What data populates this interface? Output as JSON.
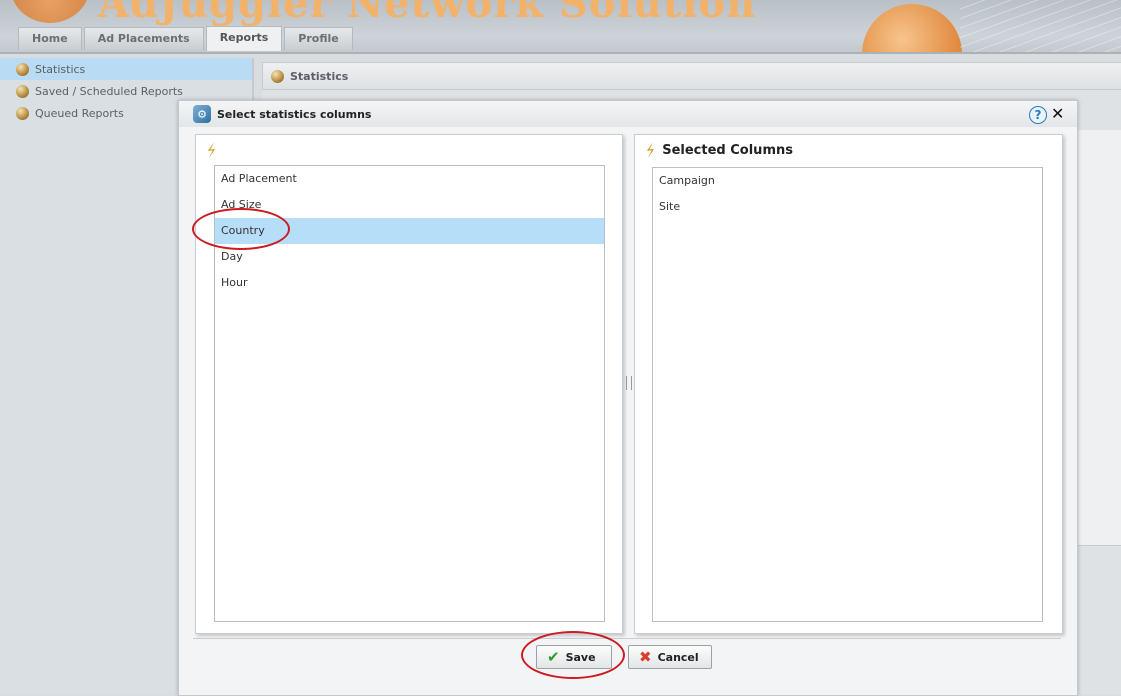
{
  "header": {
    "logo_text": "AdJuggler Network Solution"
  },
  "tabs": [
    {
      "label": "Home"
    },
    {
      "label": "Ad Placements"
    },
    {
      "label": "Reports"
    },
    {
      "label": "Profile"
    }
  ],
  "active_tab": "Reports",
  "sidebar": {
    "items": [
      {
        "label": "Statistics"
      },
      {
        "label": "Saved / Scheduled Reports"
      },
      {
        "label": "Queued Reports"
      }
    ]
  },
  "main": {
    "title": "Statistics"
  },
  "dialog": {
    "title": "Select statistics columns",
    "left_panel": {
      "heading": "",
      "items": [
        "Ad Placement",
        "Ad Size",
        "Country",
        "Day",
        "Hour"
      ],
      "selected": "Country"
    },
    "right_panel": {
      "heading": "Selected Columns",
      "items": [
        "Campaign",
        "Site"
      ]
    },
    "save_label": "Save",
    "cancel_label": "Cancel"
  },
  "colors": {
    "accent": "#b7def9",
    "annotation": "#cc1b22",
    "logo": "#f2b26a"
  }
}
